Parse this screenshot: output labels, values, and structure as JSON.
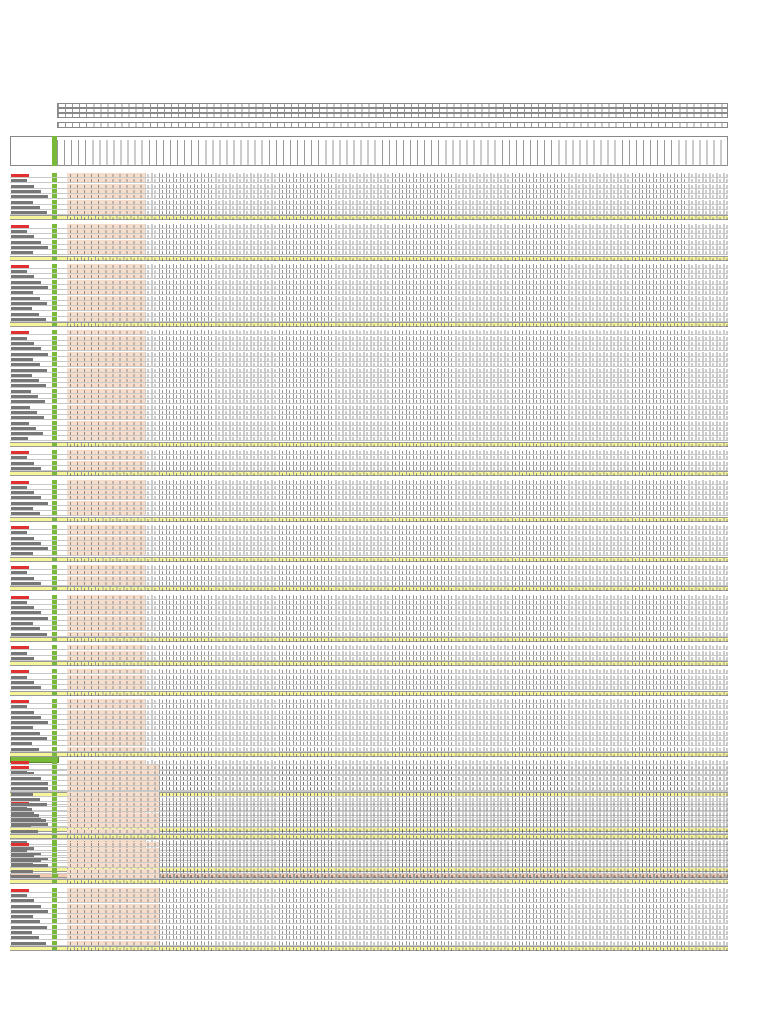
{
  "sheet": {
    "columns": 95,
    "shaded_columns_block1": 11,
    "shaded_columns_block2": 13,
    "block1_sections": [
      7,
      5,
      10,
      20,
      3,
      6,
      5,
      3,
      7,
      2,
      3,
      9,
      5,
      4,
      5
    ],
    "block2_sections": [
      12,
      6,
      10
    ]
  },
  "colors": {
    "accent_green": "#79b93a",
    "subtotal_yellow": "#f7f59a",
    "section_red": "#e03030",
    "shade_peach": "#f5dccb"
  }
}
